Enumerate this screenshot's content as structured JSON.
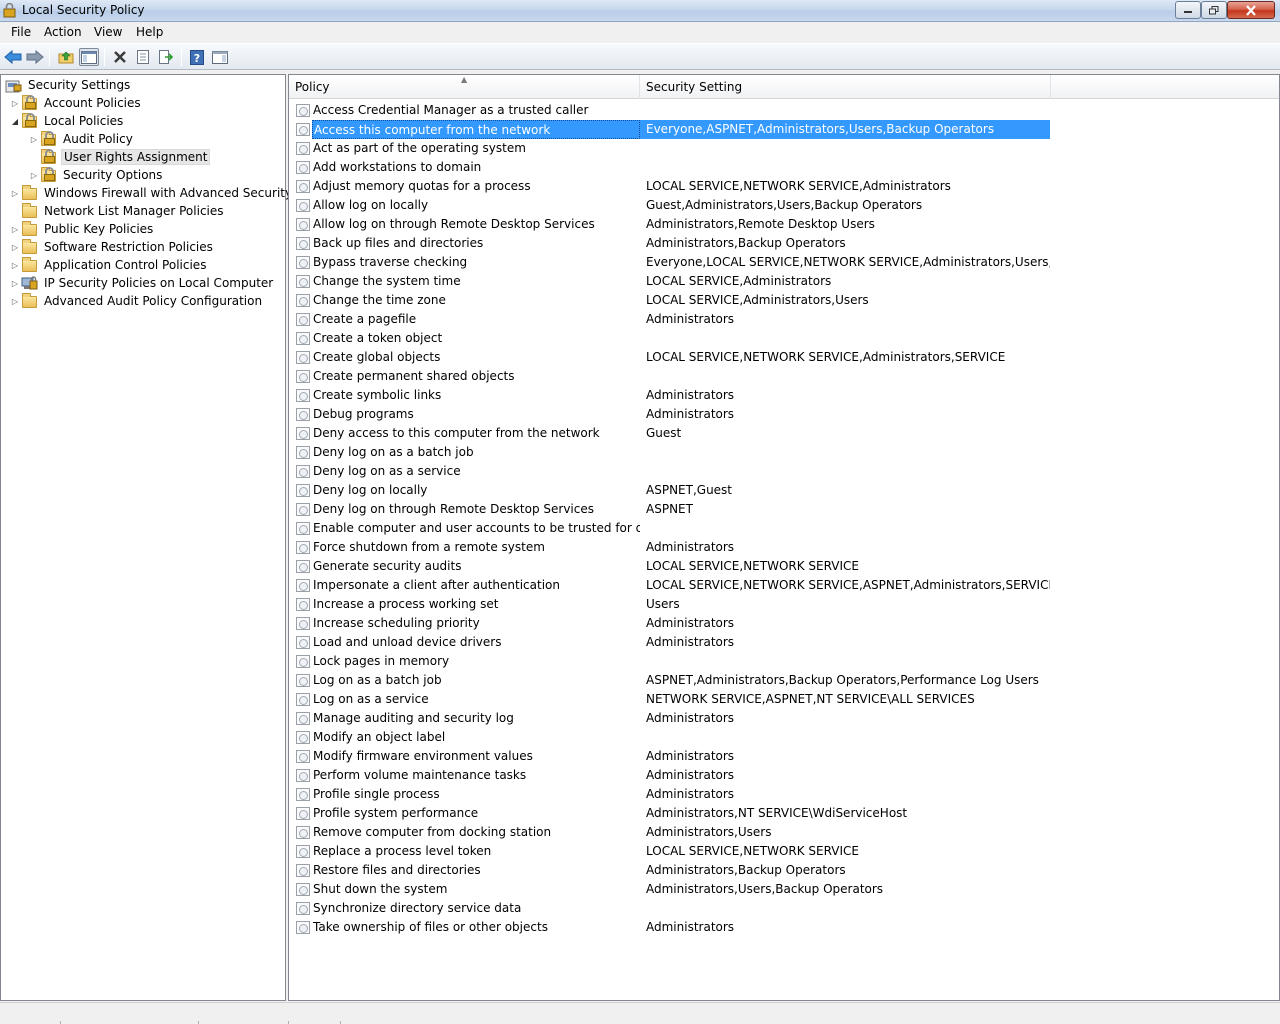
{
  "window": {
    "title": "Local Security Policy",
    "app_icon": "security-policy-icon"
  },
  "menu": [
    "File",
    "Action",
    "View",
    "Help"
  ],
  "toolbar": {
    "buttons": [
      "back-arrow-icon",
      "forward-arrow-icon",
      "up-folder-icon",
      "show-hide-tree-icon",
      "delete-icon",
      "properties-icon",
      "export-list-icon",
      "help-icon",
      "show-hide-action-pane-icon"
    ]
  },
  "tree": {
    "root": "Security Settings",
    "items": [
      {
        "label": "Account Policies",
        "expander": "collapsed",
        "icon": "locked-folder-icon"
      },
      {
        "label": "Local Policies",
        "expander": "expanded",
        "icon": "locked-folder-icon"
      },
      {
        "label": "Audit Policy",
        "expander": "collapsed",
        "icon": "locked-folder-icon"
      },
      {
        "label": "User Rights Assignment",
        "expander": "none",
        "icon": "locked-folder-icon",
        "selected": true
      },
      {
        "label": "Security Options",
        "expander": "collapsed",
        "icon": "locked-folder-icon"
      },
      {
        "label": "Windows Firewall with Advanced Security",
        "expander": "collapsed",
        "icon": "folder-icon"
      },
      {
        "label": "Network List Manager Policies",
        "expander": "none",
        "icon": "folder-icon"
      },
      {
        "label": "Public Key Policies",
        "expander": "collapsed",
        "icon": "folder-icon"
      },
      {
        "label": "Software Restriction Policies",
        "expander": "collapsed",
        "icon": "folder-icon"
      },
      {
        "label": "Application Control Policies",
        "expander": "collapsed",
        "icon": "folder-icon"
      },
      {
        "label": "IP Security Policies on Local Computer",
        "expander": "collapsed",
        "icon": "ip-security-icon"
      },
      {
        "label": "Advanced Audit Policy Configuration",
        "expander": "collapsed",
        "icon": "folder-icon"
      }
    ]
  },
  "list": {
    "columns": [
      "Policy",
      "Security Setting"
    ],
    "selected_index": 1,
    "rows": [
      {
        "policy": "Access Credential Manager as a trusted caller",
        "setting": ""
      },
      {
        "policy": "Access this computer from the network",
        "setting": "Everyone,ASPNET,Administrators,Users,Backup Operators"
      },
      {
        "policy": "Act as part of the operating system",
        "setting": ""
      },
      {
        "policy": "Add workstations to domain",
        "setting": ""
      },
      {
        "policy": "Adjust memory quotas for a process",
        "setting": "LOCAL SERVICE,NETWORK SERVICE,Administrators"
      },
      {
        "policy": "Allow log on locally",
        "setting": "Guest,Administrators,Users,Backup Operators"
      },
      {
        "policy": "Allow log on through Remote Desktop Services",
        "setting": "Administrators,Remote Desktop Users"
      },
      {
        "policy": "Back up files and directories",
        "setting": "Administrators,Backup Operators"
      },
      {
        "policy": "Bypass traverse checking",
        "setting": "Everyone,LOCAL SERVICE,NETWORK SERVICE,Administrators,Users,Backu..."
      },
      {
        "policy": "Change the system time",
        "setting": "LOCAL SERVICE,Administrators"
      },
      {
        "policy": "Change the time zone",
        "setting": "LOCAL SERVICE,Administrators,Users"
      },
      {
        "policy": "Create a pagefile",
        "setting": "Administrators"
      },
      {
        "policy": "Create a token object",
        "setting": ""
      },
      {
        "policy": "Create global objects",
        "setting": "LOCAL SERVICE,NETWORK SERVICE,Administrators,SERVICE"
      },
      {
        "policy": "Create permanent shared objects",
        "setting": ""
      },
      {
        "policy": "Create symbolic links",
        "setting": "Administrators"
      },
      {
        "policy": "Debug programs",
        "setting": "Administrators"
      },
      {
        "policy": "Deny access to this computer from the network",
        "setting": "Guest"
      },
      {
        "policy": "Deny log on as a batch job",
        "setting": ""
      },
      {
        "policy": "Deny log on as a service",
        "setting": ""
      },
      {
        "policy": "Deny log on locally",
        "setting": "ASPNET,Guest"
      },
      {
        "policy": "Deny log on through Remote Desktop Services",
        "setting": "ASPNET"
      },
      {
        "policy": "Enable computer and user accounts to be trusted for delega...",
        "setting": ""
      },
      {
        "policy": "Force shutdown from a remote system",
        "setting": "Administrators"
      },
      {
        "policy": "Generate security audits",
        "setting": "LOCAL SERVICE,NETWORK SERVICE"
      },
      {
        "policy": "Impersonate a client after authentication",
        "setting": "LOCAL SERVICE,NETWORK SERVICE,ASPNET,Administrators,SERVICE"
      },
      {
        "policy": "Increase a process working set",
        "setting": "Users"
      },
      {
        "policy": "Increase scheduling priority",
        "setting": "Administrators"
      },
      {
        "policy": "Load and unload device drivers",
        "setting": "Administrators"
      },
      {
        "policy": "Lock pages in memory",
        "setting": ""
      },
      {
        "policy": "Log on as a batch job",
        "setting": "ASPNET,Administrators,Backup Operators,Performance Log Users"
      },
      {
        "policy": "Log on as a service",
        "setting": "NETWORK SERVICE,ASPNET,NT SERVICE\\ALL SERVICES"
      },
      {
        "policy": "Manage auditing and security log",
        "setting": "Administrators"
      },
      {
        "policy": "Modify an object label",
        "setting": ""
      },
      {
        "policy": "Modify firmware environment values",
        "setting": "Administrators"
      },
      {
        "policy": "Perform volume maintenance tasks",
        "setting": "Administrators"
      },
      {
        "policy": "Profile single process",
        "setting": "Administrators"
      },
      {
        "policy": "Profile system performance",
        "setting": "Administrators,NT SERVICE\\WdiServiceHost"
      },
      {
        "policy": "Remove computer from docking station",
        "setting": "Administrators,Users"
      },
      {
        "policy": "Replace a process level token",
        "setting": "LOCAL SERVICE,NETWORK SERVICE"
      },
      {
        "policy": "Restore files and directories",
        "setting": "Administrators,Backup Operators"
      },
      {
        "policy": "Shut down the system",
        "setting": "Administrators,Users,Backup Operators"
      },
      {
        "policy": "Synchronize directory service data",
        "setting": ""
      },
      {
        "policy": "Take ownership of files or other objects",
        "setting": "Administrators"
      }
    ]
  }
}
